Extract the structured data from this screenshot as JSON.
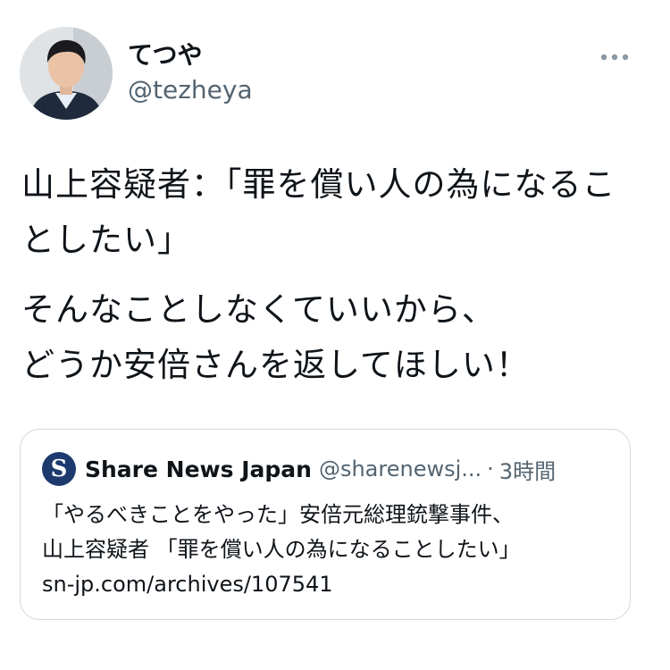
{
  "user": {
    "display_name": "てつや",
    "handle": "@tezheya",
    "avatar": "user-avatar-photo"
  },
  "menu": {
    "icon": "more-horizontal-icon"
  },
  "tweet": {
    "paragraphs": [
      "山上容疑者：「罪を償い人の為になることしたい」",
      "そんなことしなくていいから、\nどうか安倍さんを返してほしい！"
    ]
  },
  "quote": {
    "avatar_letter": "S",
    "name": "Share News Japan",
    "handle": "@sharenewsj...",
    "separator": "·",
    "time": "3時間",
    "lines": [
      "「やるべきことをやった」安倍元総理銃撃事件、",
      "山上容疑者 「罪を償い人の為になることしたい」",
      "sn-jp.com/archives/107541"
    ]
  },
  "colors": {
    "text": "#0f1419",
    "secondary": "#536471",
    "border": "#cfd9de",
    "quote_avatar_bg": "#1d3a6e"
  }
}
